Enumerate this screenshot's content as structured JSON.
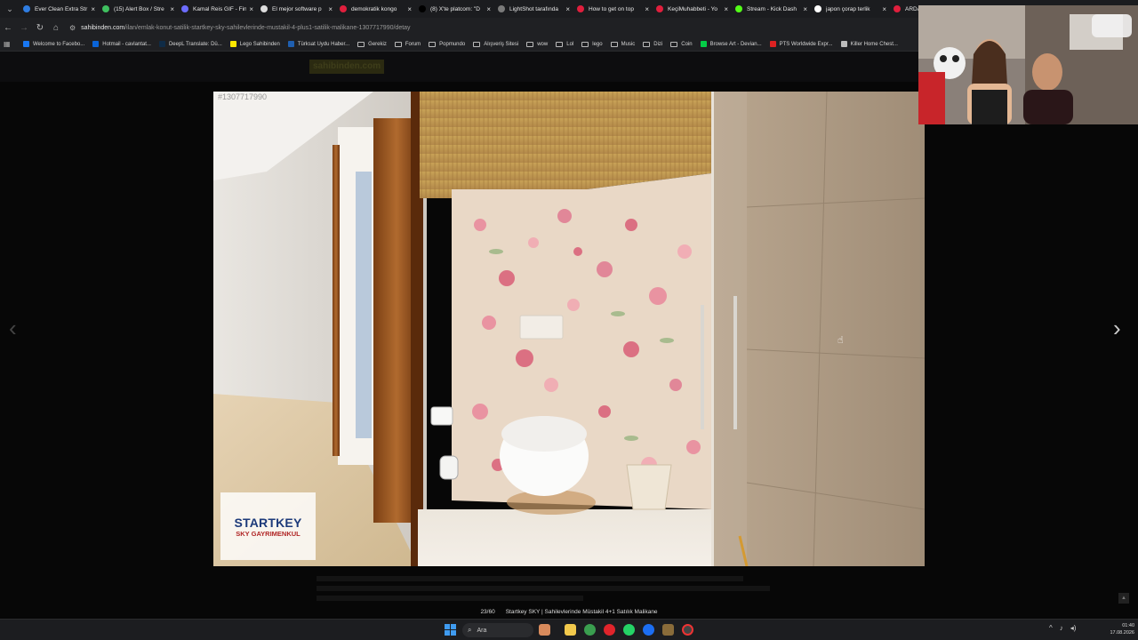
{
  "browser": {
    "tabs": [
      {
        "title": "Ever Clean Extra Str",
        "color": "#2f7de1"
      },
      {
        "title": "(15) Alert Box / Stre",
        "color": "#3fbf5f"
      },
      {
        "title": "Kamal Reis GIF - Fin",
        "color": "#6c6cff"
      },
      {
        "title": "El mejor software p",
        "color": "#dddddd"
      },
      {
        "title": "demokratik kongo",
        "color": "#e01f3d"
      },
      {
        "title": "(8) X'te platcom: \"D",
        "color": "#000000"
      },
      {
        "title": "LightShot tarafında",
        "color": "#7a7a7a"
      },
      {
        "title": "How to get on top",
        "color": "#e01f3d"
      },
      {
        "title": "KeçiMuhabbeti - Yo",
        "color": "#e01f3d"
      },
      {
        "title": "Stream - Kick Dash",
        "color": "#53fc18"
      },
      {
        "title": "japon çorap terlik",
        "color": "#ffffff"
      },
      {
        "title": "ARDA TU",
        "color": "#e01f3d"
      }
    ],
    "url_host": "sahibinden.com",
    "url_path": "/ilan/emlak-konut-satilik-startkey-sky-sahilevlerinde-mustakil-4-plus1-satilik-malikane-1307717990/detay",
    "bookmarks": [
      {
        "label": "Welcome to Facebo...",
        "type": "site",
        "color": "#1877f2"
      },
      {
        "label": "Hotmail - cavlantat...",
        "type": "site",
        "color": "#0a64d8"
      },
      {
        "label": "DeepL Translate: Dü...",
        "type": "site",
        "color": "#0f2b46"
      },
      {
        "label": "Lego Sahibinden",
        "type": "site",
        "color": "#ffe800"
      },
      {
        "label": "Türksat Uydu Haber...",
        "type": "site",
        "color": "#1f5fb0"
      },
      {
        "label": "Gerekiz",
        "type": "folder"
      },
      {
        "label": "Forum",
        "type": "folder"
      },
      {
        "label": "Popmundo",
        "type": "folder"
      },
      {
        "label": "Alışveriş Sitesi",
        "type": "folder"
      },
      {
        "label": "wow",
        "type": "folder"
      },
      {
        "label": "Lol",
        "type": "folder"
      },
      {
        "label": "lego",
        "type": "folder"
      },
      {
        "label": "Music",
        "type": "folder"
      },
      {
        "label": "Dizi",
        "type": "folder"
      },
      {
        "label": "Coin",
        "type": "folder"
      },
      {
        "label": "Browse Art - Devian...",
        "type": "site",
        "color": "#05cc47"
      },
      {
        "label": "PTS Worldwide Expr...",
        "type": "site",
        "color": "#d22"
      },
      {
        "label": "Killer Home Chest...",
        "type": "site",
        "color": "#bbbbbb"
      }
    ]
  },
  "page": {
    "site_logo": "sahibinden.com",
    "photo_id": "#1307717990",
    "watermark_brand": "STARTKEY",
    "watermark_sub": "SKY GAYRIMENKUL",
    "counter": "23/60",
    "listing_title": "Startkey SKY | Sahilevlerinde Müstakil 4+1 Satılık Malikane"
  },
  "taskbar": {
    "search_label": "Ara",
    "time": "01:40",
    "date": "17.08.2026"
  }
}
